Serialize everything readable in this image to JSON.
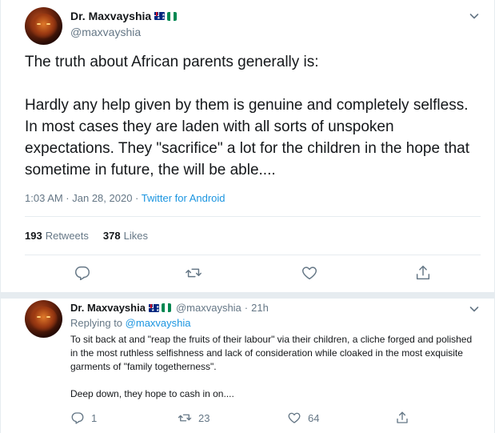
{
  "main_tweet": {
    "author_name": "Dr. Maxvayshia",
    "handle": "@maxvayshia",
    "text_intro": "The truth about African parents generally is:",
    "text_body": "Hardly any help given by them is genuine and completely selfless. In most cases they are laden with all sorts of unspoken expectations. They \"sacrifice\" a lot for the children in the hope that sometime in future, the will be able....",
    "timestamp": "1:03 AM · Jan 28, 2020",
    "separator": " · ",
    "source": "Twitter for Android",
    "retweets_count": "193",
    "retweets_label": "Retweets",
    "likes_count": "378",
    "likes_label": "Likes",
    "icons": [
      "reply-icon",
      "retweet-icon",
      "like-icon",
      "share-icon"
    ]
  },
  "reply_tweet": {
    "author_name": "Dr. Maxvayshia",
    "handle": "@maxvayshia",
    "dot": "·",
    "time": "21h",
    "replying_prefix": "Replying to",
    "replying_to": "@maxvayshia",
    "text_para1": "To sit back at and \"reap the fruits of their labour\" via their children, a cliche forged and polished in the most ruthless selfishness and lack of consideration while cloaked in the most exquisite garments of \"family togetherness\".",
    "text_para2": "Deep down, they hope to cash in on....",
    "reply_count": "1",
    "retweet_count": "23",
    "like_count": "64"
  },
  "flags": [
    "australia-flag",
    "nigeria-flag"
  ],
  "colors": {
    "link": "#1b95e0",
    "muted": "#657786",
    "text": "#14171a",
    "divider": "#e6ecf0",
    "nigeria_green": "#008751"
  }
}
